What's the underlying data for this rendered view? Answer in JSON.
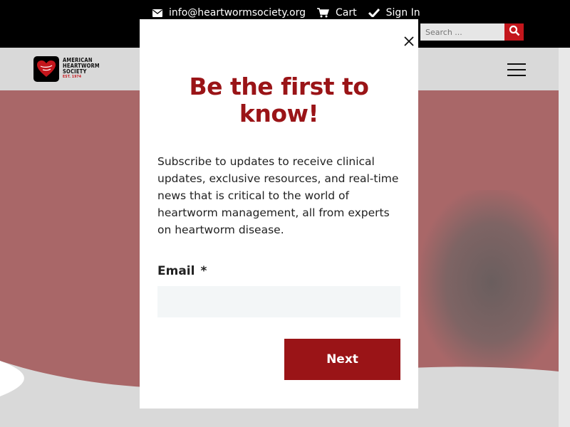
{
  "topbar": {
    "email": "info@heartwormsociety.org",
    "cart": "Cart",
    "sign_in": "Sign In",
    "search_placeholder": "Search ..."
  },
  "logo": {
    "line1": "AMERICAN",
    "line2": "HEARTWORM",
    "line3": "SOCIETY",
    "est": "EST. 1974"
  },
  "modal": {
    "title": "Be the first to know!",
    "body": "Subscribe to updates to receive clinical updates, exclusive resources, and real-time news that is critical to the world of heartworm management, all from experts on heartworm disease.",
    "email_label": "Email",
    "required_mark": "*",
    "email_value": "",
    "next_label": "Next"
  },
  "colors": {
    "brand_red": "#9a1417",
    "search_red": "#c4161c",
    "hero": "#a96768"
  },
  "icons": [
    "envelope-icon",
    "cart-icon",
    "checkmark-icon",
    "search-icon",
    "hamburger-icon",
    "close-icon"
  ]
}
